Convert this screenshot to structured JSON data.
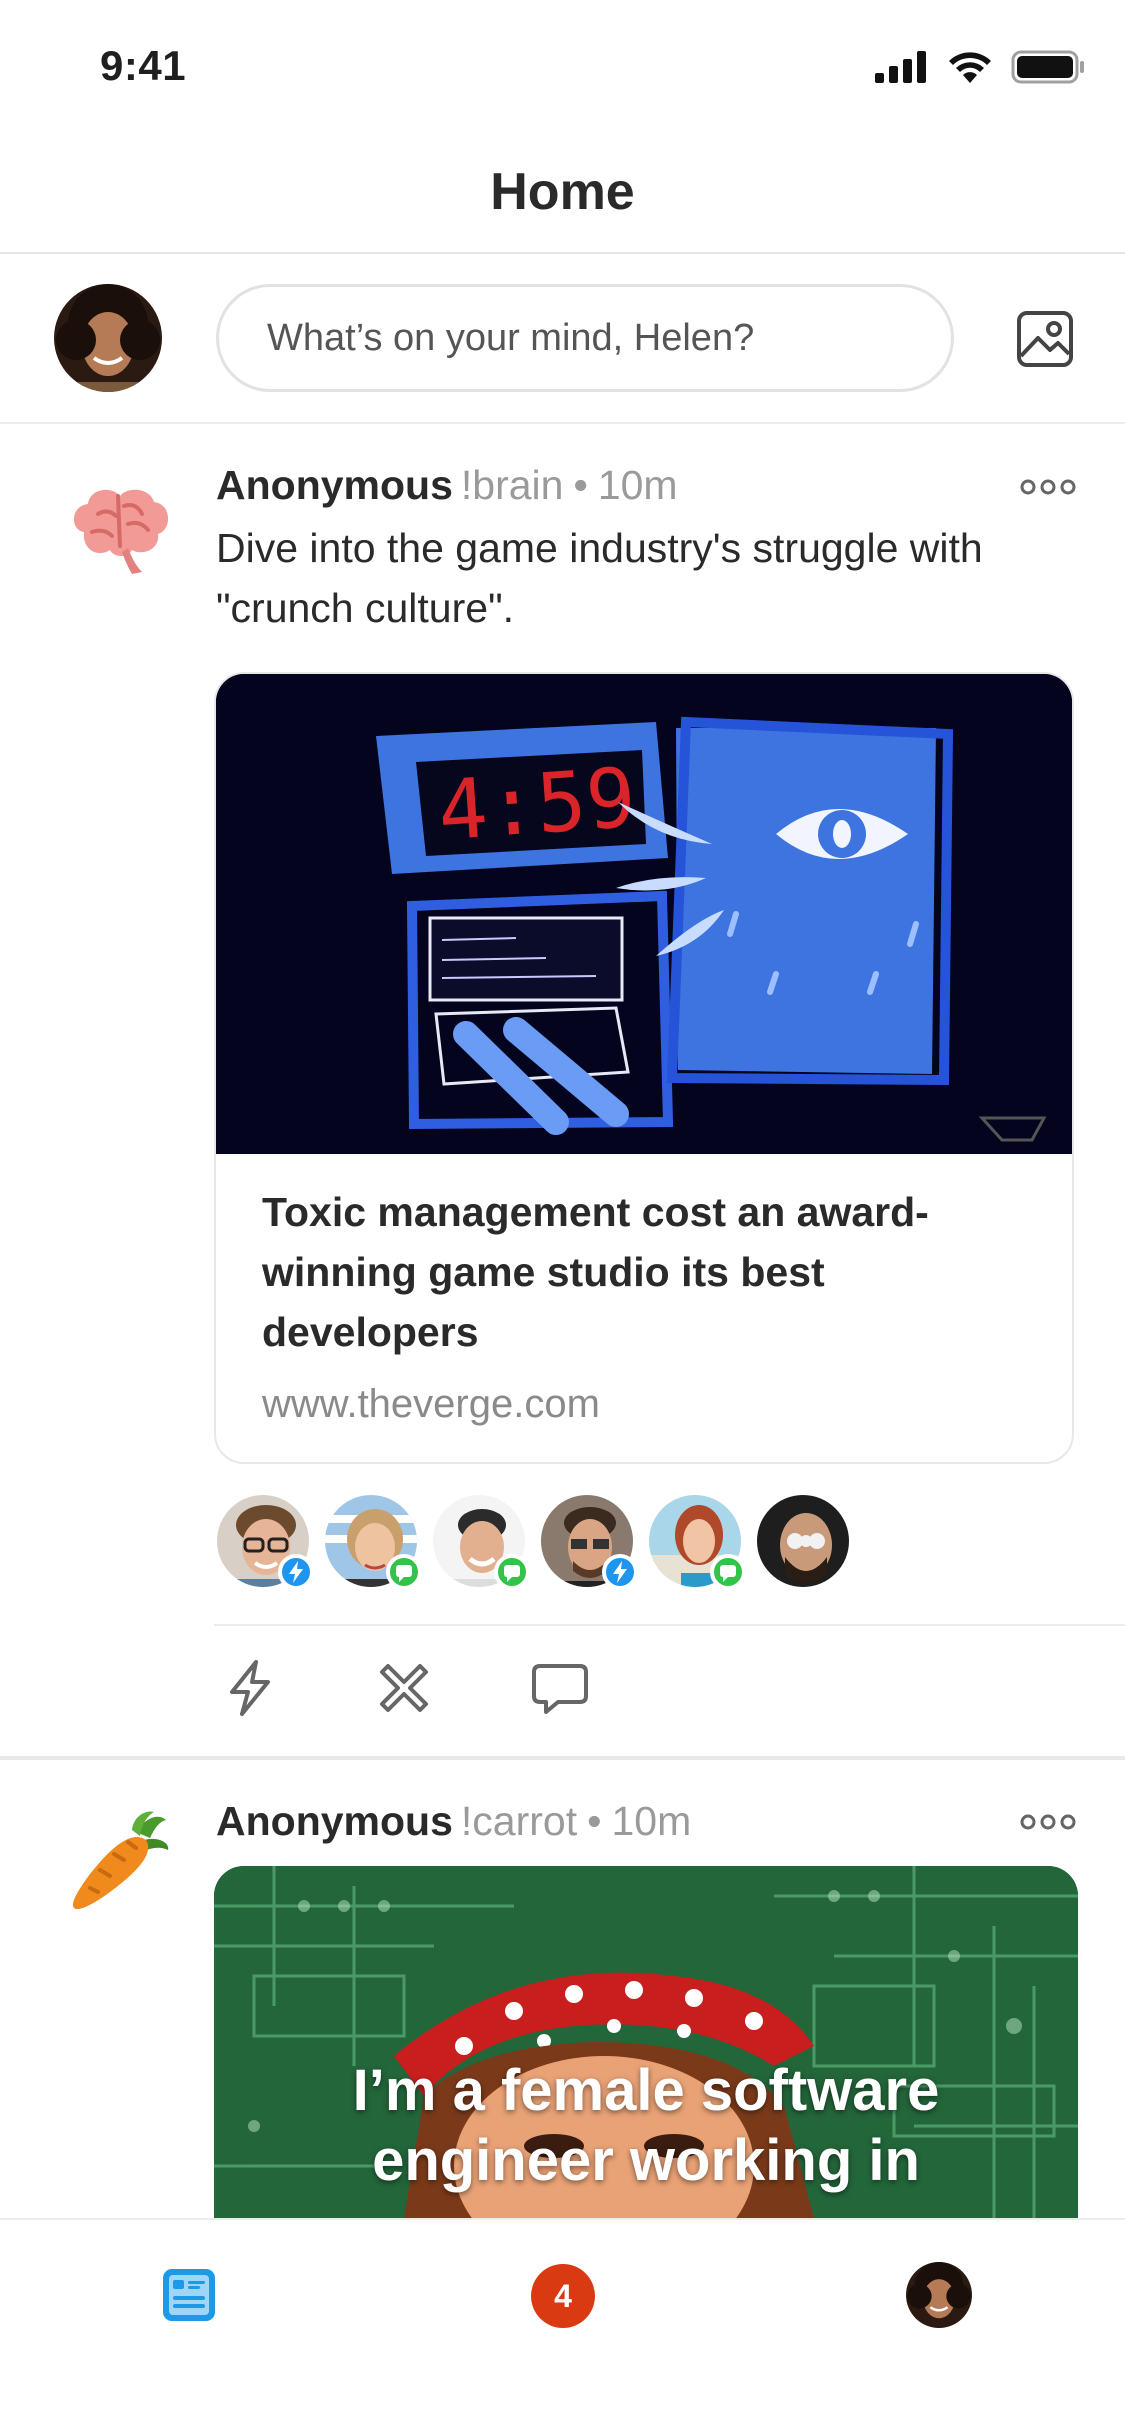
{
  "status_bar": {
    "time": "9:41"
  },
  "header": {
    "title": "Home"
  },
  "composer": {
    "placeholder": "What’s on your mind, Helen?"
  },
  "posts": [
    {
      "icon": "brain-icon",
      "author": "Anonymous",
      "tag": "!brain",
      "separator": "•",
      "ago": "10m",
      "text": "Dive into the game industry's struggle with \"crunch culture\".",
      "link": {
        "headline": "Toxic management cost an award-winning game studio its best developers",
        "domain": "www.theverge.com"
      },
      "reactions": [
        "zap",
        "message",
        "message",
        "zap",
        "message",
        "none"
      ]
    },
    {
      "icon": "carrot-icon",
      "author": "Anonymous",
      "tag": "!carrot",
      "separator": "•",
      "ago": "10m",
      "meme_caption_line1": "I’m a female software",
      "meme_caption_line2": "engineer working in"
    }
  ],
  "tabbar": {
    "notifications_count": "4"
  },
  "colors": {
    "accent_blue": "#1c9ae8",
    "zap_blue": "#1e96f0",
    "message_green": "#35c24a",
    "notification_red": "#d93a12"
  }
}
